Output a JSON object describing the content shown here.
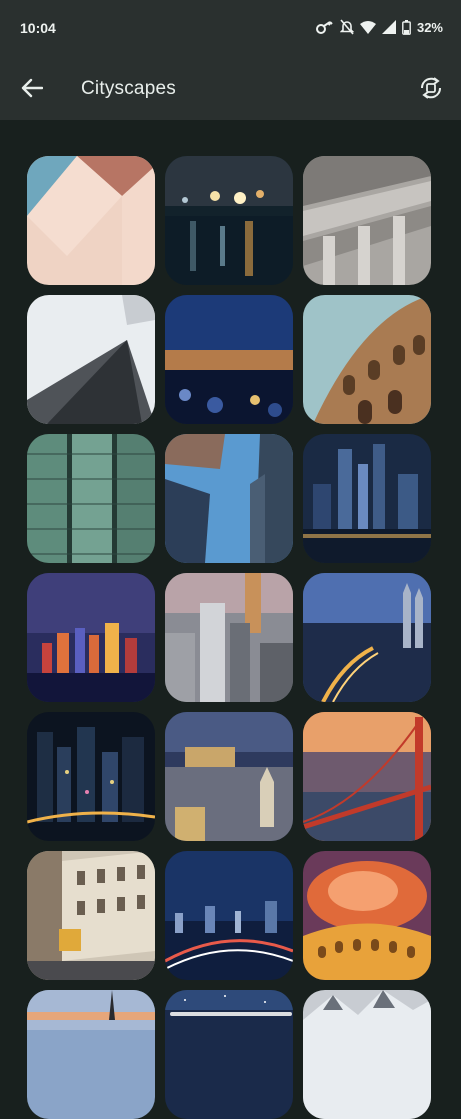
{
  "status_bar": {
    "time": "10:04",
    "battery": "32%",
    "icons": [
      "vpn-key-icon",
      "mute-icon",
      "wifi-icon",
      "signal-icon",
      "battery-icon"
    ]
  },
  "app_bar": {
    "title": "Cityscapes",
    "back_icon": "arrow-back-icon",
    "rotate_icon": "screen-rotate-icon"
  },
  "wallpapers": [
    {
      "name": "abstract-building-corner"
    },
    {
      "name": "rainy-street-bokeh"
    },
    {
      "name": "concrete-beams"
    },
    {
      "name": "skyscraper-looking-up"
    },
    {
      "name": "night-harbor-bokeh"
    },
    {
      "name": "colosseum-arches"
    },
    {
      "name": "glass-facade-towers"
    },
    {
      "name": "towers-blue-sky"
    },
    {
      "name": "night-skyline-river"
    },
    {
      "name": "waterfront-skyline-dusk"
    },
    {
      "name": "aerial-city-day"
    },
    {
      "name": "twin-towers-dusk"
    },
    {
      "name": "neon-night-city"
    },
    {
      "name": "castle-old-town-night"
    },
    {
      "name": "golden-gate-bridge-sunset"
    },
    {
      "name": "tram-old-street"
    },
    {
      "name": "highway-light-trails"
    },
    {
      "name": "colosseum-fiery-sky"
    },
    {
      "name": "dusk-church-spire"
    },
    {
      "name": "night-sky-stars"
    },
    {
      "name": "snowy-mountains"
    }
  ],
  "colors": {
    "background": "#18201e",
    "app_bar": "#2a302f",
    "text": "#e8eeeb"
  }
}
